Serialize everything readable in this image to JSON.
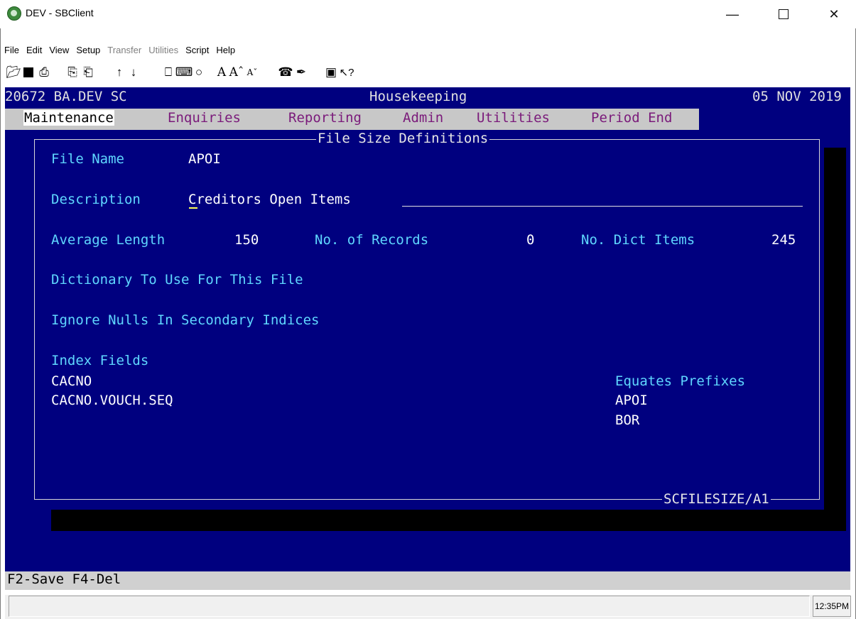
{
  "window": {
    "title": "DEV - SBClient",
    "minimize_icon": "minimize-icon",
    "maximize_icon": "maximize-icon",
    "close_icon": "close-icon"
  },
  "menubar": {
    "items": [
      "File",
      "Edit",
      "View",
      "Setup",
      "Transfer",
      "Utilities",
      "Script",
      "Help"
    ],
    "disabled": [
      "Transfer",
      "Utilities"
    ]
  },
  "toolbar": {
    "icons": [
      "open-folder-icon",
      "save-icon",
      "print-icon",
      "copy-icon",
      "paste-icon",
      "up-arrow-icon",
      "down-arrow-icon",
      "terminal-icon",
      "keyboard-icon",
      "color-palette-icon",
      "font-icon",
      "font-larger-icon",
      "font-smaller-icon",
      "phone-icon",
      "script-icon",
      "window-icon",
      "help-pointer-icon"
    ]
  },
  "terminal": {
    "status": {
      "left": "20672 BA.DEV SC",
      "center": "Housekeeping",
      "right": "05 NOV 2019"
    },
    "menu": [
      "Maintenance",
      "Enquiries",
      "Reporting",
      "Admin",
      "Utilities",
      "Period End"
    ],
    "selected_menu": "Maintenance",
    "form": {
      "title": "File Size Definitions",
      "footer": "SCFILESIZE/A1",
      "file_name_label": "File Name",
      "file_name": "APOI",
      "description_label": "Description",
      "description": "Creditors Open Items",
      "avg_length_label": "Average Length",
      "avg_length": "150",
      "records_label": "No. of Records",
      "records": "0",
      "dict_items_label": "No. Dict Items",
      "dict_items": "245",
      "dictionary_label": "Dictionary To Use For This File",
      "ignore_nulls_label": "Ignore Nulls In Secondary Indices",
      "index_fields_label": "Index Fields",
      "index_fields": [
        "CACNO",
        "CACNO.VOUCH.SEQ"
      ],
      "equates_label": "Equates Prefixes",
      "equates": [
        "APOI",
        "BOR"
      ]
    },
    "function_keys": "F2-Save F4-Del"
  },
  "statusbar": {
    "message": "",
    "clock": "12:35PM"
  },
  "colors": {
    "terminal_bg": "#00007f",
    "label": "#5fd7ff",
    "value": "#ffffff",
    "menu_bar": "#c8c8c8",
    "menu_text": "#7a1a7a"
  }
}
